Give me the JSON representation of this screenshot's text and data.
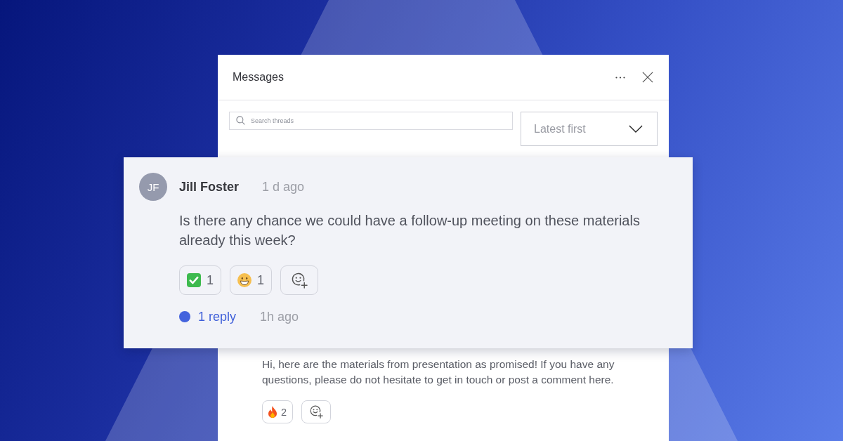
{
  "window": {
    "title": "Messages"
  },
  "search": {
    "placeholder": "Search threads"
  },
  "sort": {
    "value": "Latest first"
  },
  "thread": {
    "initials": "JF",
    "author": "Jill Foster",
    "time": "1 d ago",
    "text": "Is there any chance we could have a follow-up meeting on these materials already this week?",
    "reactions": [
      {
        "kind": "check",
        "count": "1"
      },
      {
        "kind": "grin",
        "count": "1"
      }
    ],
    "replies": {
      "label": "1 reply",
      "time": "1h ago",
      "unread": true
    }
  },
  "message": {
    "text": "Hi, here are the materials from presentation as promised! If you have any questions, please do not hesitate to get in touch or post a comment here.",
    "reactions": [
      {
        "kind": "fire",
        "count": "2"
      }
    ]
  }
}
